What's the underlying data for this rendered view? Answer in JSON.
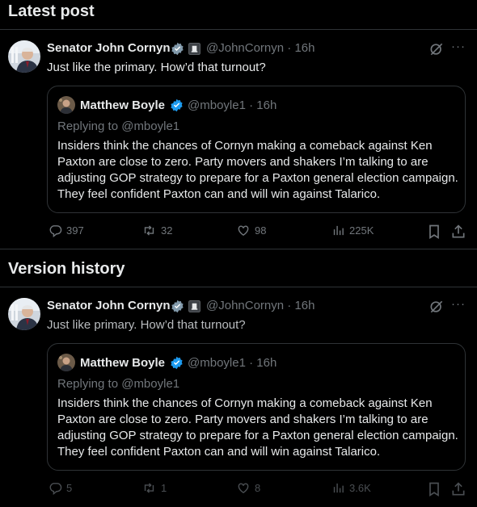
{
  "sections": {
    "latest_title": "Latest post",
    "history_title": "Version history"
  },
  "latest": {
    "author_name": "Senator John Cornyn",
    "author_handle": "@JohnCornyn · 16h",
    "text": "Just like the primary. How’d that turnout?",
    "quote": {
      "name": "Matthew Boyle",
      "handle": "@mboyle1 · 16h",
      "replying": "Replying to @mboyle1",
      "body": "Insiders think the chances of Cornyn making a comeback against Ken Paxton are close to zero. Party movers and shakers I’m talking to are adjusting GOP strategy to prepare for a Paxton general election campaign. They feel confident Paxton can and will win against Talarico."
    },
    "stats": {
      "replies": "397",
      "reposts": "32",
      "likes": "98",
      "views": "225K"
    }
  },
  "history": {
    "author_name": "Senator John Cornyn",
    "author_handle": "@JohnCornyn · 16h",
    "text": "Just like primary. How’d that turnout?",
    "quote": {
      "name": "Matthew Boyle",
      "handle": "@mboyle1 · 16h",
      "replying": "Replying to @mboyle1",
      "body": "Insiders think the chances of Cornyn making a comeback against Ken Paxton are close to zero. Party movers and shakers I’m talking to are adjusting GOP strategy to prepare for a Paxton general election campaign. They feel confident Paxton can and will win against Talarico."
    },
    "stats": {
      "replies": "5",
      "reposts": "1",
      "likes": "8",
      "views": "3.6K"
    }
  },
  "colors": {
    "background": "#000000",
    "text": "#e7e9ea",
    "muted": "#71767b",
    "border": "#2f3336",
    "verified_blue": "#1d9bf0"
  },
  "icons": [
    "grok-icon",
    "more-icon",
    "reply-icon",
    "repost-icon",
    "like-icon",
    "views-icon",
    "bookmark-icon",
    "share-icon",
    "verified-icon",
    "gov-badge-icon"
  ]
}
